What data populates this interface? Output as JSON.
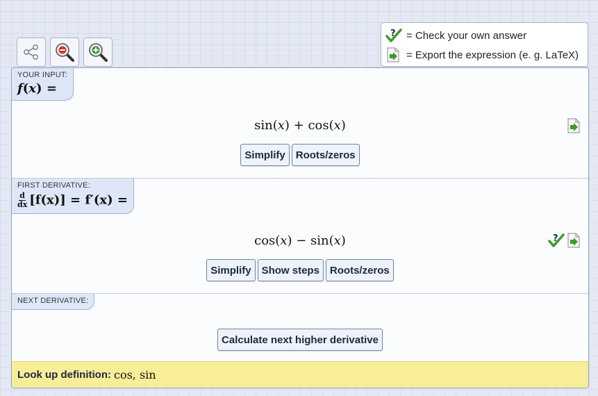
{
  "toolbar": {
    "share_icon": "share-icon",
    "zoom_out_icon": "zoom-out-icon",
    "zoom_in_icon": "zoom-in-icon"
  },
  "legend": {
    "check_text": "= Check your own answer",
    "export_text": "= Export the expression (e. g. LaTeX)"
  },
  "input": {
    "label": "YOUR INPUT:",
    "lhs_fn": "f",
    "lhs_var": "x",
    "lhs_eq": "=",
    "expr_a": "sin(",
    "expr_var1": "x",
    "expr_b": ") + cos(",
    "expr_var2": "x",
    "expr_c": ")",
    "buttons": [
      "Simplify",
      "Roots/zeros"
    ]
  },
  "first_derivative": {
    "label": "FIRST DERIVATIVE:",
    "frac_num": "d",
    "frac_den": "dx",
    "lhs_text": "[f(x)] = f′(x) =",
    "expr_a": "cos(",
    "expr_var1": "x",
    "expr_b": ") − sin(",
    "expr_var2": "x",
    "expr_c": ")",
    "buttons": [
      "Simplify",
      "Show steps",
      "Roots/zeros"
    ]
  },
  "next_derivative": {
    "label": "NEXT DERIVATIVE:",
    "button": "Calculate next higher derivative"
  },
  "lookup": {
    "label": "Look up definition:",
    "functions": "cos, sin"
  },
  "colors": {
    "accent_green": "#3f9a2a",
    "check_navy": "#1d2d55",
    "lookup_bg": "#f8ed98",
    "tag_bg": "#dee7f7"
  }
}
